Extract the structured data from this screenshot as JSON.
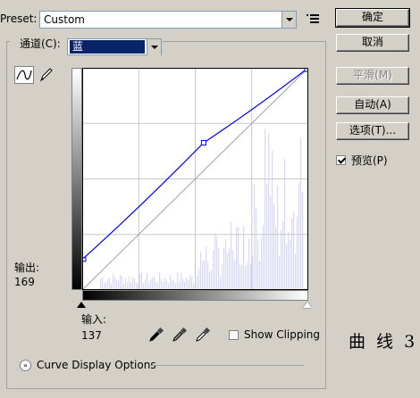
{
  "preset": {
    "label": "Preset:",
    "value": "Custom"
  },
  "channel": {
    "label": "通道(C):",
    "value": "蓝"
  },
  "output": {
    "label": "输出:",
    "value": "169"
  },
  "input": {
    "label": "输入:",
    "value": "137"
  },
  "show_clipping": {
    "label": "Show Clipping",
    "checked": false
  },
  "curve_display_options": {
    "label": "Curve Display Options"
  },
  "buttons": {
    "ok": "确定",
    "reset": "取消",
    "smooth": "平滑(M)",
    "auto": "自动(A)",
    "options": "选项(T)..."
  },
  "preview": {
    "label": "预览(P)",
    "checked": true
  },
  "caption": "曲 线 3",
  "curve": {
    "color": "#0000ff",
    "histogram_color": "#d8d8f8",
    "points": [
      [
        0,
        35
      ],
      [
        137,
        169
      ],
      [
        255,
        255
      ]
    ]
  }
}
